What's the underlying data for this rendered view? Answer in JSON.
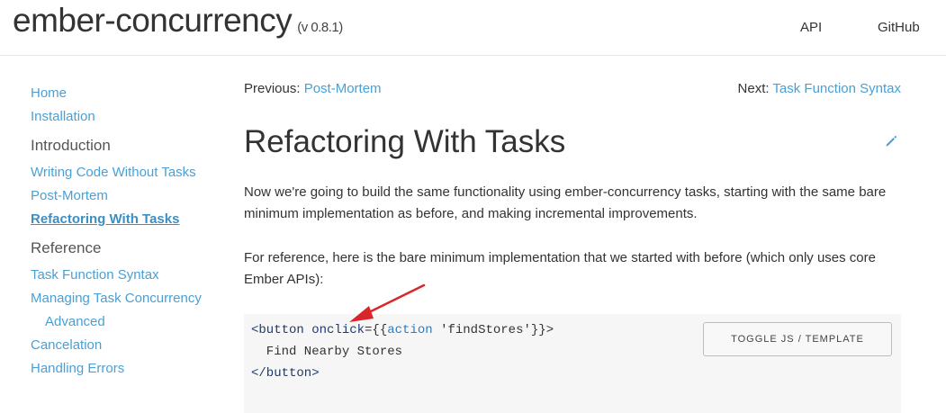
{
  "header": {
    "brand": "ember-concurrency",
    "version": "(v 0.8.1)",
    "nav": [
      "API",
      "GitHub"
    ]
  },
  "sidebar": {
    "items": [
      {
        "label": "Home",
        "type": "link"
      },
      {
        "label": "Installation",
        "type": "link"
      },
      {
        "label": "Introduction",
        "type": "section"
      },
      {
        "label": "Writing Code Without Tasks",
        "type": "link"
      },
      {
        "label": "Post-Mortem",
        "type": "link"
      },
      {
        "label": "Refactoring With Tasks",
        "type": "link",
        "active": true
      },
      {
        "label": "Reference",
        "type": "section"
      },
      {
        "label": "Task Function Syntax",
        "type": "link"
      },
      {
        "label": "Managing Task Concurrency",
        "type": "link"
      },
      {
        "label": "Advanced",
        "type": "sublink"
      },
      {
        "label": "Cancelation",
        "type": "link"
      },
      {
        "label": "Handling Errors",
        "type": "link"
      }
    ]
  },
  "pager": {
    "prev_prefix": "Previous: ",
    "prev_label": "Post-Mortem",
    "next_prefix": "Next: ",
    "next_label": "Task Function Syntax"
  },
  "page": {
    "title": "Refactoring With Tasks",
    "edit_icon": "pencil-icon",
    "paragraph1": "Now we're going to build the same functionality using ember-concurrency tasks, starting with the same bare minimum implementation as before, and making incremental improvements.",
    "paragraph2": "For reference, here is the bare minimum implementation that we started with before (which only uses core Ember APIs):"
  },
  "code": {
    "line1_tag_open": "<button",
    "line1_attr": "onclick",
    "line1_eq": "={{",
    "line1_kw": "action",
    "line1_str": " 'findStores'",
    "line1_close": "}}>",
    "line2": "  Find Nearby Stores",
    "line3": "</button>",
    "toggle_label": "TOGGLE JS / TEMPLATE"
  },
  "annotation": {
    "arrow_color": "#d9262b"
  }
}
